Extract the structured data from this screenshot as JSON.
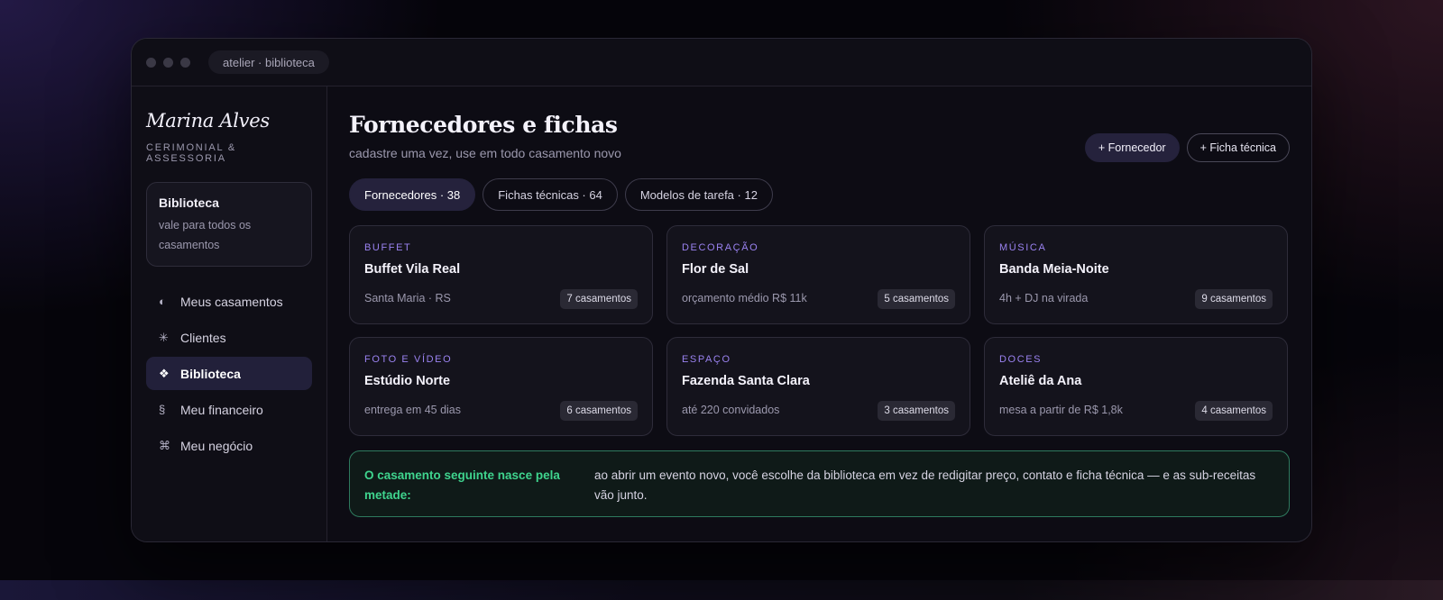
{
  "window": {
    "address": "atelier · biblioteca"
  },
  "sidebar": {
    "brand_name": "Marina Alves",
    "brand_sub": "CERIMONIAL & ASSESSORIA",
    "library_card": {
      "title": "Biblioteca",
      "description": "vale para todos os casamentos"
    },
    "items": [
      {
        "label": "Meus casamentos",
        "icon": "◐",
        "icon_name": "half-circle-icon",
        "active": false
      },
      {
        "label": "Clientes",
        "icon": "✳",
        "icon_name": "asterisk-icon",
        "active": false
      },
      {
        "label": "Biblioteca",
        "icon": "❖",
        "icon_name": "diamond-icon",
        "active": true
      },
      {
        "label": "Meu financeiro",
        "icon": "§",
        "icon_name": "section-icon",
        "active": false
      },
      {
        "label": "Meu negócio",
        "icon": "⌘",
        "icon_name": "command-icon",
        "active": false
      }
    ]
  },
  "main": {
    "title": "Fornecedores e fichas",
    "subtitle": "cadastre uma vez, use em todo casamento novo",
    "actions": {
      "add_supplier": "+ Fornecedor",
      "add_sheet": "+ Ficha técnica"
    },
    "tabs": [
      {
        "label": "Fornecedores · 38",
        "active": true
      },
      {
        "label": "Fichas técnicas · 64",
        "active": false
      },
      {
        "label": "Modelos de tarefa · 12",
        "active": false
      }
    ],
    "cards": [
      {
        "category": "BUFFET",
        "name": "Buffet Vila Real",
        "detail": "Santa Maria · RS",
        "badge": "7 casamentos"
      },
      {
        "category": "DECORAÇÃO",
        "name": "Flor de Sal",
        "detail": "orçamento médio R$ 11k",
        "badge": "5 casamentos"
      },
      {
        "category": "MÚSICA",
        "name": "Banda Meia-Noite",
        "detail": "4h + DJ na virada",
        "badge": "9 casamentos"
      },
      {
        "category": "FOTO E VÍDEO",
        "name": "Estúdio Norte",
        "detail": "entrega em 45 dias",
        "badge": "6 casamentos"
      },
      {
        "category": "ESPAÇO",
        "name": "Fazenda Santa Clara",
        "detail": "até 220 convidados",
        "badge": "3 casamentos"
      },
      {
        "category": "DOCES",
        "name": "Ateliê da Ana",
        "detail": "mesa a partir de R$ 1,8k",
        "badge": "4 casamentos"
      }
    ],
    "note": {
      "title": "O casamento seguinte nasce pela metade:",
      "text": "ao abrir um evento novo, você escolhe da biblioteca em vez de redigitar preço, contato e ficha técnica — e as sub-receitas vão junto."
    }
  },
  "colors": {
    "accent": "#9a82f0",
    "success": "#3fd48e",
    "active_bg": "#25223c"
  }
}
